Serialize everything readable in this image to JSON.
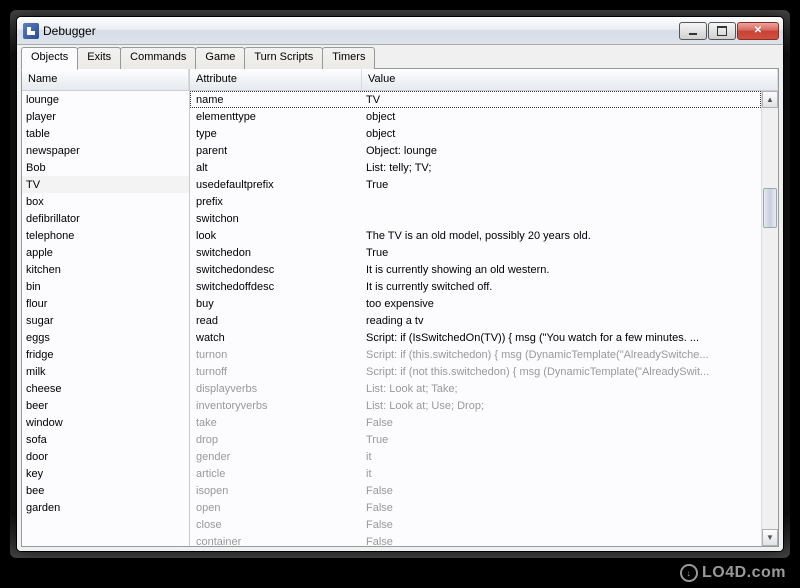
{
  "window": {
    "title": "Debugger"
  },
  "tabs": [
    {
      "label": "Objects",
      "active": true
    },
    {
      "label": "Exits",
      "active": false
    },
    {
      "label": "Commands",
      "active": false
    },
    {
      "label": "Game",
      "active": false
    },
    {
      "label": "Turn Scripts",
      "active": false
    },
    {
      "label": "Timers",
      "active": false
    }
  ],
  "left": {
    "header": "Name",
    "selected": "TV",
    "items": [
      "lounge",
      "player",
      "table",
      "newspaper",
      "Bob",
      "TV",
      "box",
      "defibrillator",
      "telephone",
      "apple",
      "kitchen",
      "bin",
      "flour",
      "sugar",
      "eggs",
      "fridge",
      "milk",
      "cheese",
      "beer",
      "window",
      "sofa",
      "door",
      "key",
      "bee",
      "garden"
    ]
  },
  "right": {
    "headers": {
      "attr": "Attribute",
      "val": "Value"
    },
    "highlighted": "name",
    "rows": [
      {
        "attr": "name",
        "val": "TV",
        "inherited": false
      },
      {
        "attr": "elementtype",
        "val": "object",
        "inherited": false
      },
      {
        "attr": "type",
        "val": "object",
        "inherited": false
      },
      {
        "attr": "parent",
        "val": "Object: lounge",
        "inherited": false
      },
      {
        "attr": "alt",
        "val": "List: telly; TV;",
        "inherited": false
      },
      {
        "attr": "usedefaultprefix",
        "val": "True",
        "inherited": false
      },
      {
        "attr": "prefix",
        "val": "",
        "inherited": false
      },
      {
        "attr": "switchon",
        "val": "",
        "inherited": false
      },
      {
        "attr": "look",
        "val": "The TV is an old model, possibly 20 years old.",
        "inherited": false
      },
      {
        "attr": "switchedon",
        "val": "True",
        "inherited": false
      },
      {
        "attr": "switchedondesc",
        "val": "It is currently showing an old western.",
        "inherited": false
      },
      {
        "attr": "switchedoffdesc",
        "val": "It is currently switched off.",
        "inherited": false
      },
      {
        "attr": "buy",
        "val": "too expensive",
        "inherited": false
      },
      {
        "attr": "read",
        "val": "reading a tv",
        "inherited": false
      },
      {
        "attr": "watch",
        "val": "Script: if (IsSwitchedOn(TV)) {        msg (\"You watch for a few minutes. ...",
        "inherited": false
      },
      {
        "attr": "turnon",
        "val": "Script: if (this.switchedon) {        msg (DynamicTemplate(\"AlreadySwitche...",
        "inherited": true
      },
      {
        "attr": "turnoff",
        "val": "Script: if (not this.switchedon) {        msg (DynamicTemplate(\"AlreadySwit...",
        "inherited": true
      },
      {
        "attr": "displayverbs",
        "val": "List: Look at; Take;",
        "inherited": true
      },
      {
        "attr": "inventoryverbs",
        "val": "List: Look at; Use; Drop;",
        "inherited": true
      },
      {
        "attr": "take",
        "val": "False",
        "inherited": true
      },
      {
        "attr": "drop",
        "val": "True",
        "inherited": true
      },
      {
        "attr": "gender",
        "val": "it",
        "inherited": true
      },
      {
        "attr": "article",
        "val": "it",
        "inherited": true
      },
      {
        "attr": "isopen",
        "val": "False",
        "inherited": true
      },
      {
        "attr": "open",
        "val": "False",
        "inherited": true
      },
      {
        "attr": "close",
        "val": "False",
        "inherited": true
      },
      {
        "attr": "container",
        "val": "False",
        "inherited": true
      }
    ]
  },
  "watermark": "LO4D.com"
}
